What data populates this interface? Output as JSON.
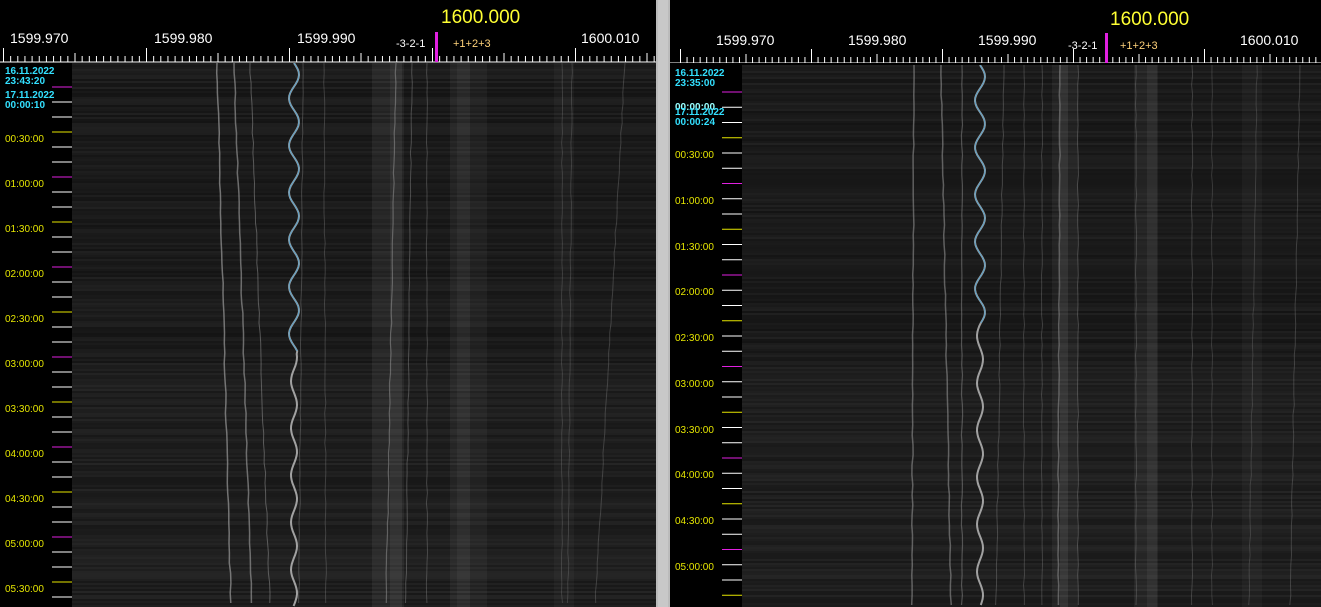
{
  "panels": [
    {
      "center_freq": "1600.000",
      "freq_labels": [
        "1599.970",
        "1599.980",
        "1599.990",
        "1600.010"
      ],
      "neg_offsets": "-3-2-1",
      "pos_offsets": "+1+2+3",
      "start_date": "16.11.2022",
      "start_time": "23:43:20",
      "second_date": "17.11.2022",
      "second_time": "00:00:10",
      "time_labels": [
        "00:30:00",
        "01:00:00",
        "01:30:00",
        "02:00:00",
        "02:30:00",
        "03:00:00",
        "03:30:00",
        "04:00:00",
        "04:30:00",
        "05:00:00",
        "05:30:00"
      ]
    },
    {
      "center_freq": "1600.000",
      "freq_labels": [
        "1599.970",
        "1599.980",
        "1599.990",
        "1600.010"
      ],
      "neg_offsets": "-3-2-1",
      "pos_offsets": "+1+2+3",
      "start_date": "16.11.2022",
      "start_time": "23:35:00",
      "overlap_time": "00:00:00",
      "second_date": "17.11.2022",
      "second_time": "00:00:24",
      "time_labels": [
        "00:30:00",
        "01:00:00",
        "01:30:00",
        "02:00:00",
        "02:30:00",
        "03:00:00",
        "03:30:00",
        "04:00:00",
        "04:30:00",
        "05:00:00"
      ]
    }
  ],
  "colors": {
    "center_marker": "#e020e0",
    "freq_title": "#ffff33",
    "time_label": "#e6e600",
    "date_label": "#33e0ff",
    "hour_tick": "#e020e0",
    "half_tick": "#e6e600",
    "minor_tick": "#ffffff",
    "waterfall_bg": "#1c1c1c",
    "trace": "#9a9a9a",
    "trace_hi": "#3aa0d8"
  }
}
